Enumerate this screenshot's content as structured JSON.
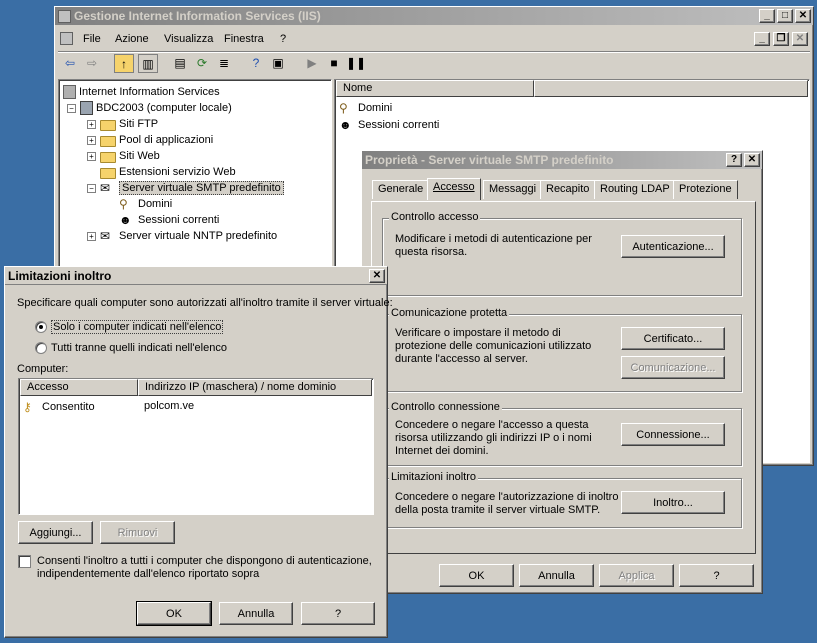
{
  "iis": {
    "title": "Gestione Internet Information Services (IIS)",
    "menu": [
      "File",
      "Azione",
      "Visualizza",
      "Finestra",
      "?"
    ],
    "tree": {
      "root": "Internet Information Services",
      "computer": "BDC2003 (computer locale)",
      "items": [
        "Siti FTP",
        "Pool di applicazioni",
        "Siti Web",
        "Estensioni servizio Web",
        "Server virtuale SMTP predefinito"
      ],
      "smtp_children": [
        "Domini",
        "Sessioni correnti"
      ],
      "nntp": "Server virtuale NNTP predefinito"
    },
    "list": {
      "header_name": "Nome",
      "items": [
        "Domini",
        "Sessioni correnti"
      ]
    }
  },
  "props": {
    "title": "Proprietà - Server virtuale SMTP predefinito",
    "tabs": [
      "Generale",
      "Accesso",
      "Messaggi",
      "Recapito",
      "Routing LDAP",
      "Protezione"
    ],
    "selected_tab": "Accesso",
    "groups": {
      "access": {
        "title": "Controllo accesso",
        "text": "Modificare i metodi di autenticazione per questa risorsa.",
        "button": "Autenticazione..."
      },
      "secure": {
        "title": "Comunicazione protetta",
        "text": "Verificare o impostare il metodo di protezione delle comunicazioni utilizzato durante l'accesso al server.",
        "button1": "Certificato...",
        "button2": "Comunicazione..."
      },
      "connection": {
        "title": "Controllo connessione",
        "text": "Concedere o negare l'accesso a questa risorsa utilizzando gli indirizzi IP o i nomi Internet dei domini.",
        "button": "Connessione..."
      },
      "relay": {
        "title": "Limitazioni inoltro",
        "text": "Concedere o negare l'autorizzazione di inoltro della posta tramite il server virtuale SMTP.",
        "button": "Inoltro..."
      }
    },
    "buttons": {
      "ok": "OK",
      "cancel": "Annulla",
      "apply": "Applica",
      "help": "?"
    }
  },
  "relay": {
    "title": "Limitazioni inoltro",
    "close": "✕",
    "instruction": "Specificare quali computer sono autorizzati all'inoltro tramite il server virtuale:",
    "radio_only": "Solo i computer indicati nell'elenco",
    "radio_all": "Tutti tranne quelli indicati nell'elenco",
    "radio_selected": "only",
    "computer_label": "Computer:",
    "columns": [
      "Accesso",
      "Indirizzo IP (maschera) / nome dominio"
    ],
    "rows": [
      {
        "access": "Consentito",
        "address": "polcom.ve"
      }
    ],
    "add_button": "Aggiungi...",
    "remove_button": "Rimuovi",
    "checkbox_text_line1": "Consenti l'inoltro a tutti i computer che dispongono di autenticazione,",
    "checkbox_text_line2": "indipendentemente dall'elenco riportato sopra",
    "checkbox_checked": false,
    "buttons": {
      "ok": "OK",
      "cancel": "Annulla",
      "help": "?"
    }
  },
  "colors": {
    "desktop": "#3a6ea5",
    "title_active": "#0a246a",
    "face": "#d4d0c8"
  }
}
